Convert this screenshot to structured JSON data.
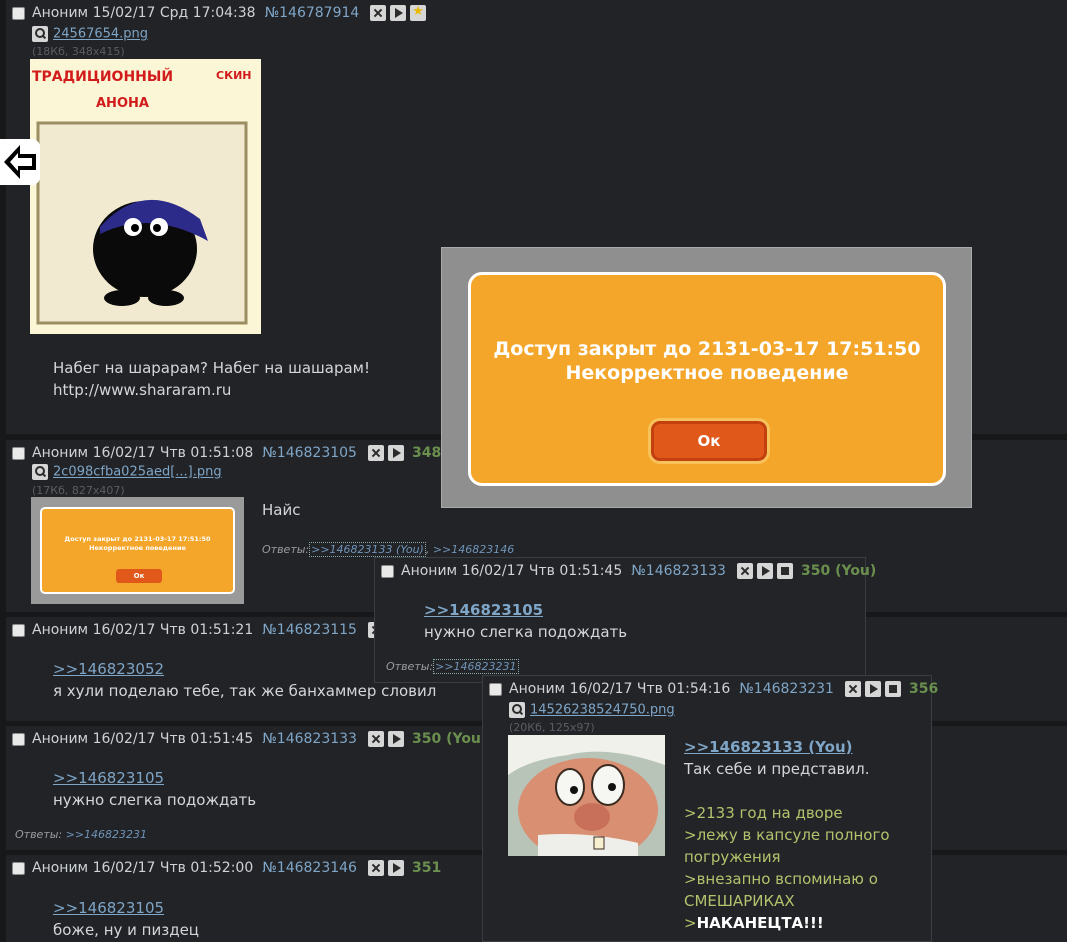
{
  "posts": {
    "p1": {
      "author": "Аноним",
      "date": "15/02/17 Срд 17:04:38",
      "num": "№146787914",
      "file": "24567654.png",
      "fsize": "(18Кб, 348x415)",
      "thumb_caption_1": "ТРАДИЦИОННЫЙ",
      "thumb_caption_2": "СКИН",
      "thumb_caption_3": "АНОНА",
      "line1": "Набег на шарарам? Набег на шашарам!",
      "line2": "http://www.shararam.ru"
    },
    "p2": {
      "author": "Аноним",
      "date": "16/02/17 Чтв 01:51:08",
      "num": "№146823105",
      "count": "348",
      "file": "2c098cfba025aed[...].png",
      "fsize": "(17Кб, 827x407)",
      "thumb_line1": "Доступ закрыт до 2131-03-17 17:51:50",
      "thumb_line2": "Некорректное поведение",
      "thumb_ok": "Ок",
      "text": "Найс",
      "replies_label": "Ответы:",
      "reply1": ">>146823133 (You)",
      "reply2": ">>146823146"
    },
    "p3": {
      "author": "Аноним",
      "date": "16/02/17 Чтв 01:51:21",
      "num": "№146823115",
      "ref": ">>146823052",
      "text": "я хули поделаю тебе, так же банхаммер словил"
    },
    "p4": {
      "author": "Аноним",
      "date": "16/02/17 Чтв 01:51:45",
      "num": "№146823133",
      "count": "350 (You)",
      "ref": ">>146823105",
      "text": "нужно слегка подождать",
      "replies_label": "Ответы:",
      "reply1": ">>146823231"
    },
    "p5": {
      "author": "Аноним",
      "date": "16/02/17 Чтв 01:52:00",
      "num": "№146823146",
      "count": "351",
      "ref": ">>146823105",
      "text": "боже, ну и пиздец"
    }
  },
  "float1": {
    "author": "Аноним",
    "date": "16/02/17 Чтв 01:51:45",
    "num": "№146823133",
    "count": "350 (You)",
    "ref": ">>146823105",
    "text": "нужно слегка подождать",
    "replies_label": "Ответы:",
    "reply1": ">>146823231"
  },
  "float2": {
    "author": "Аноним",
    "date": "16/02/17 Чтв 01:54:16",
    "num": "№146823231",
    "count": "356",
    "file": "14526238524750.png",
    "fsize": "(20Кб, 125x97)",
    "ref": ">>146823133 (You)",
    "text": "Так себе и представил.",
    "q1": ">2133 год на дворе",
    "q2a": ">лежу в капсуле полного",
    "q2b": "погружения",
    "q3a": ">внезапно вспоминаю о",
    "q3b": "СМЕШАРИКАХ",
    "q4_prefix": ">",
    "q4_bold": "НАКАНЕЦТА!!!"
  },
  "modal": {
    "line1": "Доступ закрыт до 2131-03-17 17:51:50",
    "line2": "Некорректное поведение",
    "ok": "Ок"
  },
  "colors": {
    "accent": "#7fa5c7",
    "quote": "#b2c36c",
    "count": "#6a8f4e",
    "modal": "#f4a62a",
    "ok": "#e0581a"
  }
}
